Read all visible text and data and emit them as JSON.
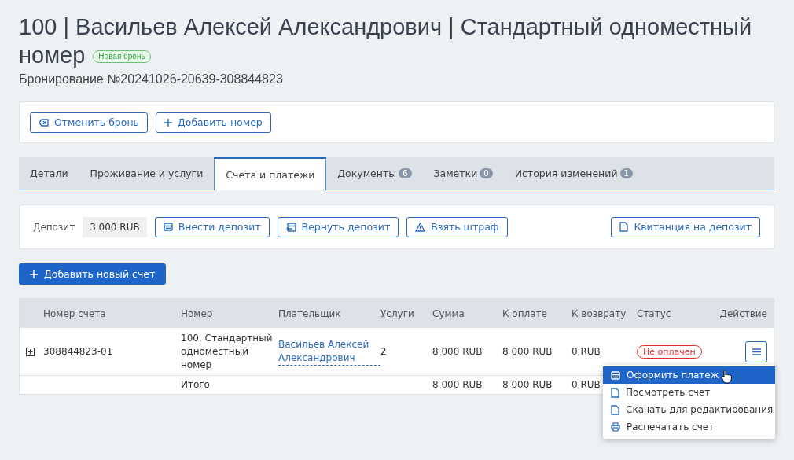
{
  "header": {
    "title": "100 | Васильев Алексей Александрович | Стандартный одноместный номер",
    "badge": "Новая бронь",
    "subtitle": "Бронирование №20241026-20639-308844823"
  },
  "toolbar": [
    {
      "label": "Отменить бронь",
      "kind": "cancel"
    },
    {
      "label": "Добавить номер",
      "kind": "plus"
    }
  ],
  "tabs": [
    {
      "label": "Детали",
      "selected": false
    },
    {
      "label": "Проживание и услуги",
      "selected": false
    },
    {
      "label": "Счета и платежи",
      "selected": true
    },
    {
      "label": "Документы",
      "count": "6",
      "selected": false
    },
    {
      "label": "Заметки",
      "count": "0",
      "selected": false
    },
    {
      "label": "История изменений",
      "count": "1",
      "selected": false
    }
  ],
  "deposit": {
    "label": "Депозит",
    "value": "3 000 RUB",
    "buttons": [
      {
        "label": "Внести депозит",
        "kind": "card"
      },
      {
        "label": "Вернуть депозит",
        "kind": "card-back"
      },
      {
        "label": "Взять штраф",
        "kind": "warning"
      }
    ],
    "receipt_button": {
      "label": "Квитанция на депозит",
      "kind": "doc"
    }
  },
  "add_invoice_button": "Добавить новый счет",
  "table": {
    "columns": [
      "Номер счета",
      "Номер",
      "Плательщик",
      "Услуги",
      "Сумма",
      "К оплате",
      "К возврату",
      "Статус",
      "Действие"
    ],
    "rows": [
      {
        "number": "308844823-01",
        "room": "100, Стандартный одноместный номер",
        "payer": "Васильев Алексей Александрович",
        "services": "2",
        "sum": "8 000 RUB",
        "to_pay": "8 000 RUB",
        "refund": "0 RUB",
        "status": "Не оплачен",
        "paid": false
      }
    ],
    "total": {
      "label": "Итого",
      "sum": "8 000 RUB",
      "to_pay": "8 000 RUB",
      "refund": "0 RUB"
    }
  },
  "action_menu": [
    {
      "label": "Оформить платеж",
      "kind": "card",
      "selected": true
    },
    {
      "label": "Посмотреть счет",
      "kind": "doc",
      "selected": false
    },
    {
      "label": "Скачать для редактирования",
      "kind": "doc",
      "selected": false
    },
    {
      "label": "Распечатать счет",
      "kind": "print",
      "selected": false
    }
  ]
}
